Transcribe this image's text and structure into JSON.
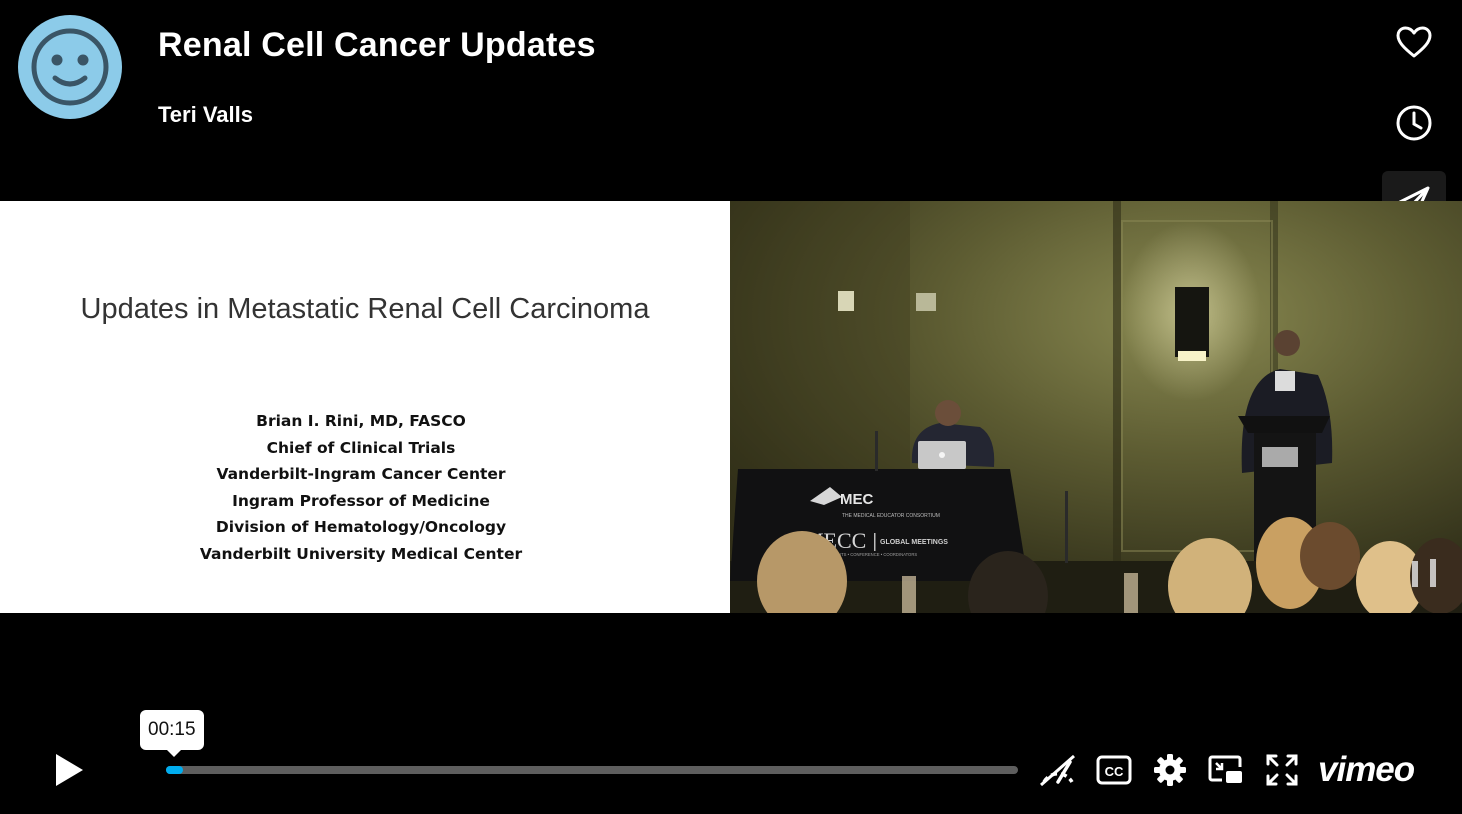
{
  "header": {
    "title": "Renal Cell Cancer Updates",
    "author": "Teri Valls"
  },
  "actions": {
    "like": "heart-icon",
    "watch_later": "clock-icon",
    "share": "paper-plane-icon"
  },
  "slide": {
    "title": "Updates in Metastatic Renal Cell Carcinoma",
    "lines": [
      "Brian I. Rini, MD, FASCO",
      "Chief of Clinical Trials",
      "Vanderbilt-Ingram Cancer Center",
      "Ingram Professor of Medicine",
      "Division of Hematology/Oncology",
      "Vanderbilt University Medical Center"
    ]
  },
  "stage": {
    "table_banner_1": "MEC",
    "table_banner_1_sub": "THE MEDICAL EDUCATOR CONSORTIUM",
    "table_banner_2": "MECC",
    "table_banner_2_sub": "GLOBAL MEETINGS",
    "table_banner_2_tag": "MEETINGS • EVENTS • CONFERENCE • COORDINATORS"
  },
  "player": {
    "current_time": "00:15",
    "progress_fraction": 0.02,
    "brand": "vimeo",
    "accent_color": "#00adef",
    "icons": [
      "play-icon",
      "speed-icon",
      "captions-icon",
      "settings-icon",
      "picture-in-picture-icon",
      "fullscreen-icon"
    ]
  }
}
